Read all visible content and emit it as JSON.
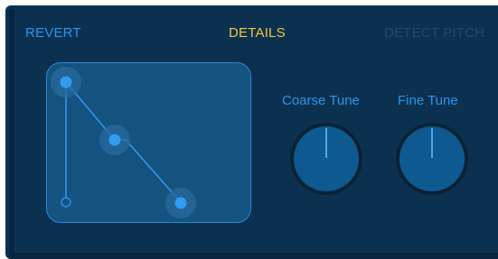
{
  "header": {
    "revert_label": "REVERT",
    "details_label": "DETAILS",
    "detect_pitch_label": "DETECT PITCH"
  },
  "knobs": {
    "coarse_tune_label": "Coarse Tune",
    "fine_tune_label": "Fine Tune"
  },
  "colors": {
    "panel_bg": "#0c3150",
    "accent_blue": "#2a95ee",
    "active_tab": "#f2c83c",
    "disabled_text": "#1c4c74"
  }
}
